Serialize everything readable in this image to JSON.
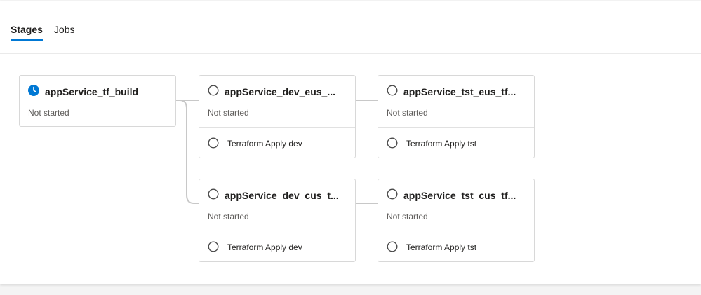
{
  "tabs": [
    {
      "label": "Stages",
      "selected": true
    },
    {
      "label": "Jobs",
      "selected": false
    }
  ],
  "stages": [
    {
      "title": "appService_tf_build",
      "status": "Not started",
      "state": "queued"
    },
    {
      "title": "appService_dev_eus_...",
      "status": "Not started",
      "state": "not-started",
      "job": "Terraform Apply dev"
    },
    {
      "title": "appService_tst_eus_tf...",
      "status": "Not started",
      "state": "not-started",
      "job": "Terraform Apply tst"
    },
    {
      "title": "appService_dev_cus_t...",
      "status": "Not started",
      "state": "not-started",
      "job": "Terraform Apply dev"
    },
    {
      "title": "appService_tst_cus_tf...",
      "status": "Not started",
      "state": "not-started",
      "job": "Terraform Apply tst"
    }
  ],
  "colors": {
    "accent": "#0078d4",
    "connector": "#c8c8c8",
    "border": "#d8d8d8"
  },
  "icons": {
    "queued": "clock-icon",
    "not-started": "empty-circle-icon"
  }
}
